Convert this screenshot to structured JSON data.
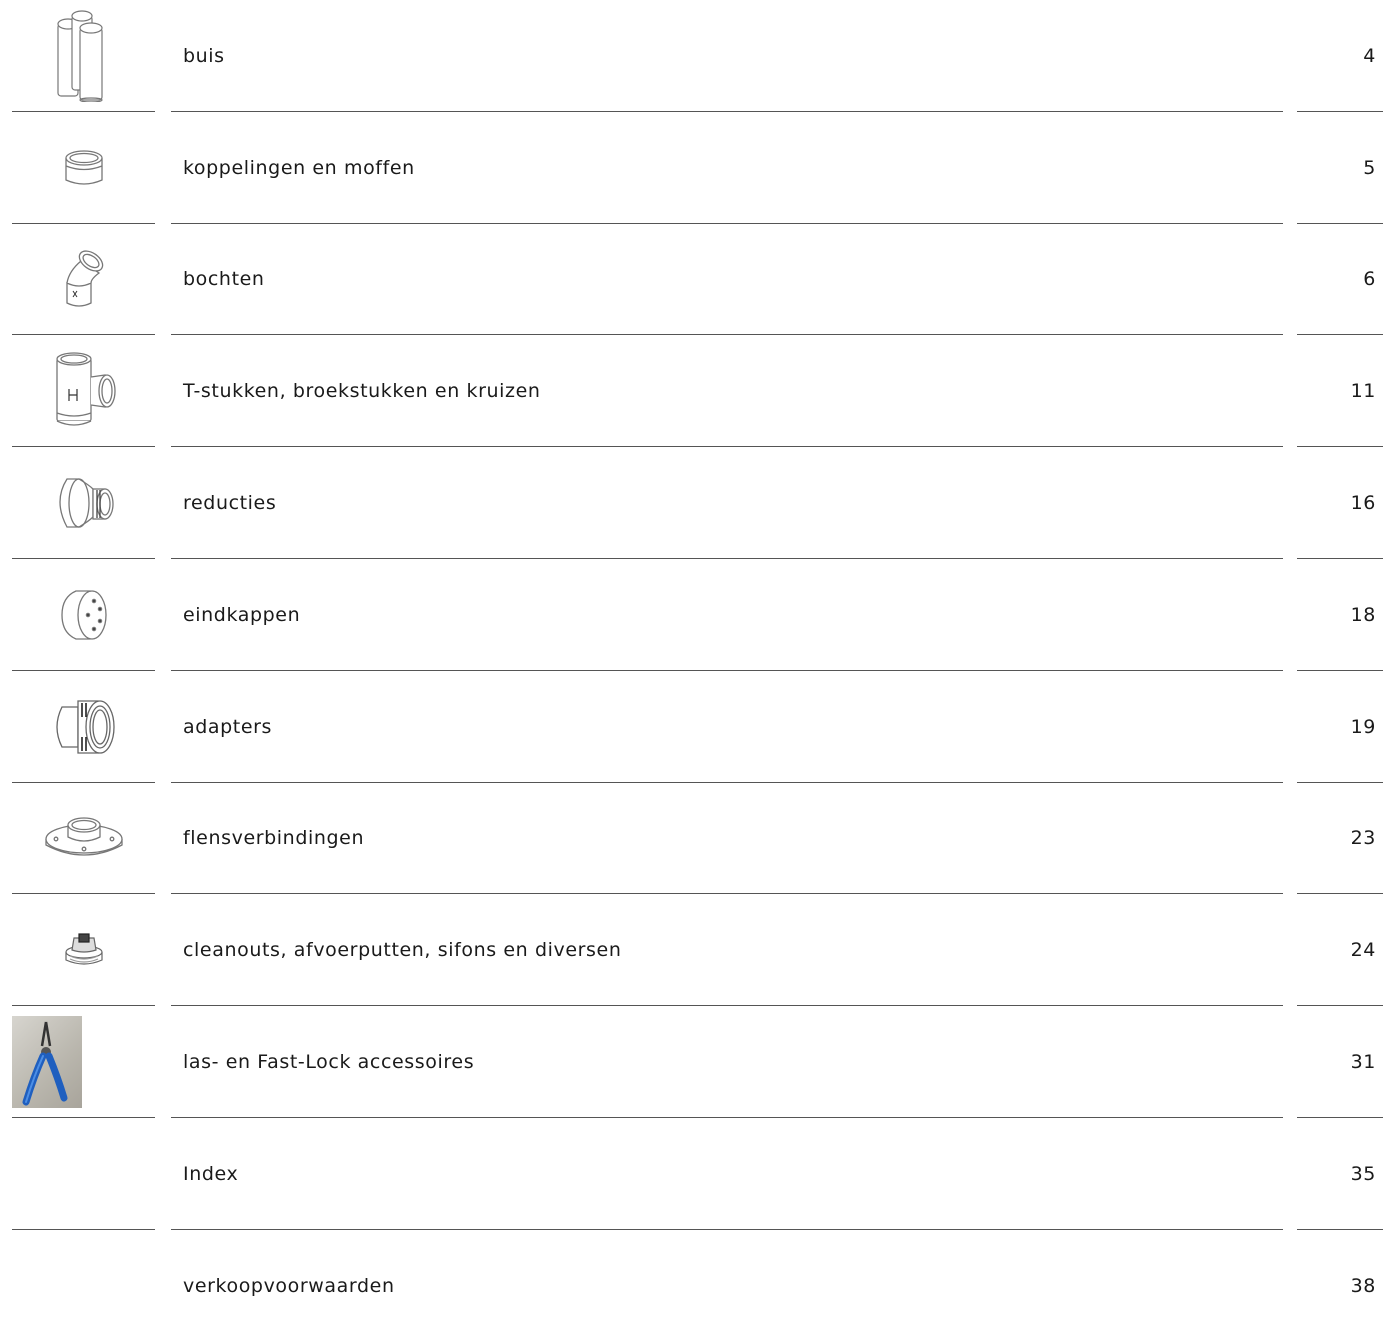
{
  "toc": [
    {
      "label": "buis",
      "page": "4",
      "icon": "pipes-icon"
    },
    {
      "label": "koppelingen en moffen",
      "page": "5",
      "icon": "coupling-icon"
    },
    {
      "label": "bochten",
      "page": "6",
      "icon": "elbow-icon"
    },
    {
      "label": "T-stukken, broekstukken en kruizen",
      "page": "11",
      "icon": "tee-fitting-icon"
    },
    {
      "label": "reducties",
      "page": "16",
      "icon": "reducer-icon"
    },
    {
      "label": "eindkappen",
      "page": "18",
      "icon": "end-cap-icon"
    },
    {
      "label": "adapters",
      "page": "19",
      "icon": "adapter-icon"
    },
    {
      "label": "flensverbindingen",
      "page": "23",
      "icon": "flange-icon"
    },
    {
      "label": "cleanouts, afvoerputten, sifons en diversen",
      "page": "24",
      "icon": "cleanout-icon"
    },
    {
      "label": "las- en Fast-Lock accessoires",
      "page": "31",
      "icon": "pliers-photo"
    },
    {
      "label": "Index",
      "page": "35",
      "icon": ""
    },
    {
      "label": "verkoopvoorwaarden",
      "page": "38",
      "icon": ""
    }
  ]
}
